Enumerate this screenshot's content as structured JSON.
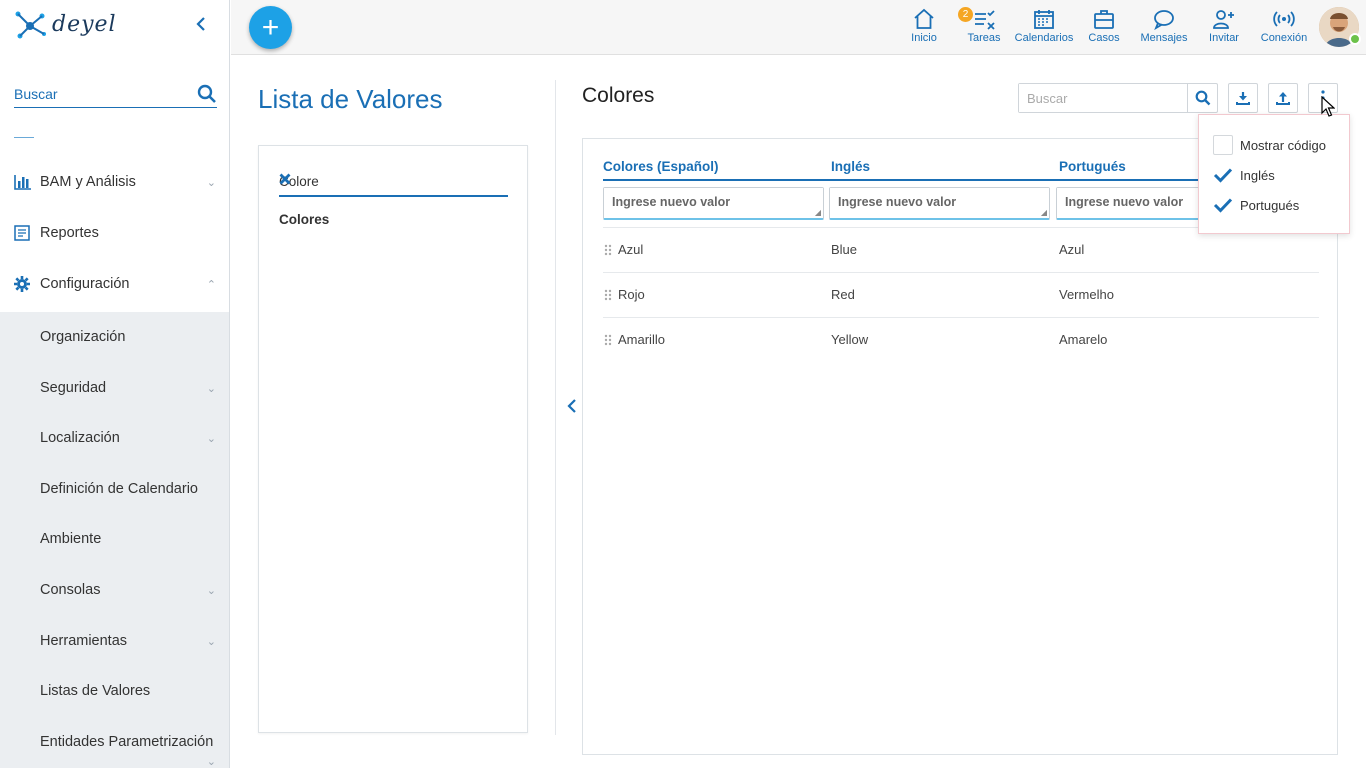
{
  "app": {
    "logo_text": "deyel"
  },
  "sidebar": {
    "search_placeholder": "Buscar",
    "items": [
      {
        "label": "BAM y Análisis",
        "icon": "bar-chart-icon"
      },
      {
        "label": "Reportes",
        "icon": "report-icon"
      },
      {
        "label": "Configuración",
        "icon": "gear-icon"
      }
    ],
    "subitems": [
      {
        "label": "Organización"
      },
      {
        "label": "Seguridad"
      },
      {
        "label": "Localización"
      },
      {
        "label": "Definición de Calendario"
      },
      {
        "label": "Ambiente"
      },
      {
        "label": "Consolas"
      },
      {
        "label": "Herramientas"
      },
      {
        "label": "Listas de Valores"
      },
      {
        "label": "Entidades Parametrización"
      }
    ]
  },
  "header": {
    "nav": [
      {
        "label": "Inicio",
        "icon": "home-icon"
      },
      {
        "label": "Tareas",
        "icon": "tasks-icon",
        "badge": "2"
      },
      {
        "label": "Calendarios",
        "icon": "calendar-icon"
      },
      {
        "label": "Casos",
        "icon": "briefcase-icon"
      },
      {
        "label": "Mensajes",
        "icon": "chat-icon"
      },
      {
        "label": "Invitar",
        "icon": "add-user-icon"
      },
      {
        "label": "Conexión",
        "icon": "signal-icon"
      }
    ],
    "colors": {
      "accent": "#1a6fb5",
      "fab": "#1da1e6",
      "badge": "#f5a623",
      "online": "#6cc24a"
    }
  },
  "left_panel": {
    "title": "Lista de Valores",
    "filter_value": "Colore",
    "list": [
      "Colores"
    ]
  },
  "right_panel": {
    "title": "Colores",
    "search_placeholder": "Buscar",
    "columns": [
      "Colores (Español)",
      "Inglés",
      "Portugués"
    ],
    "new_value_placeholder": "Ingrese nuevo valor",
    "rows": [
      [
        "Azul",
        "Blue",
        "Azul"
      ],
      [
        "Rojo",
        "Red",
        "Vermelho"
      ],
      [
        "Amarillo",
        "Yellow",
        "Amarelo"
      ]
    ]
  },
  "menu": {
    "items": [
      {
        "label": "Mostrar código",
        "checked": false
      },
      {
        "label": "Inglés",
        "checked": true
      },
      {
        "label": "Portugués",
        "checked": true
      }
    ]
  }
}
